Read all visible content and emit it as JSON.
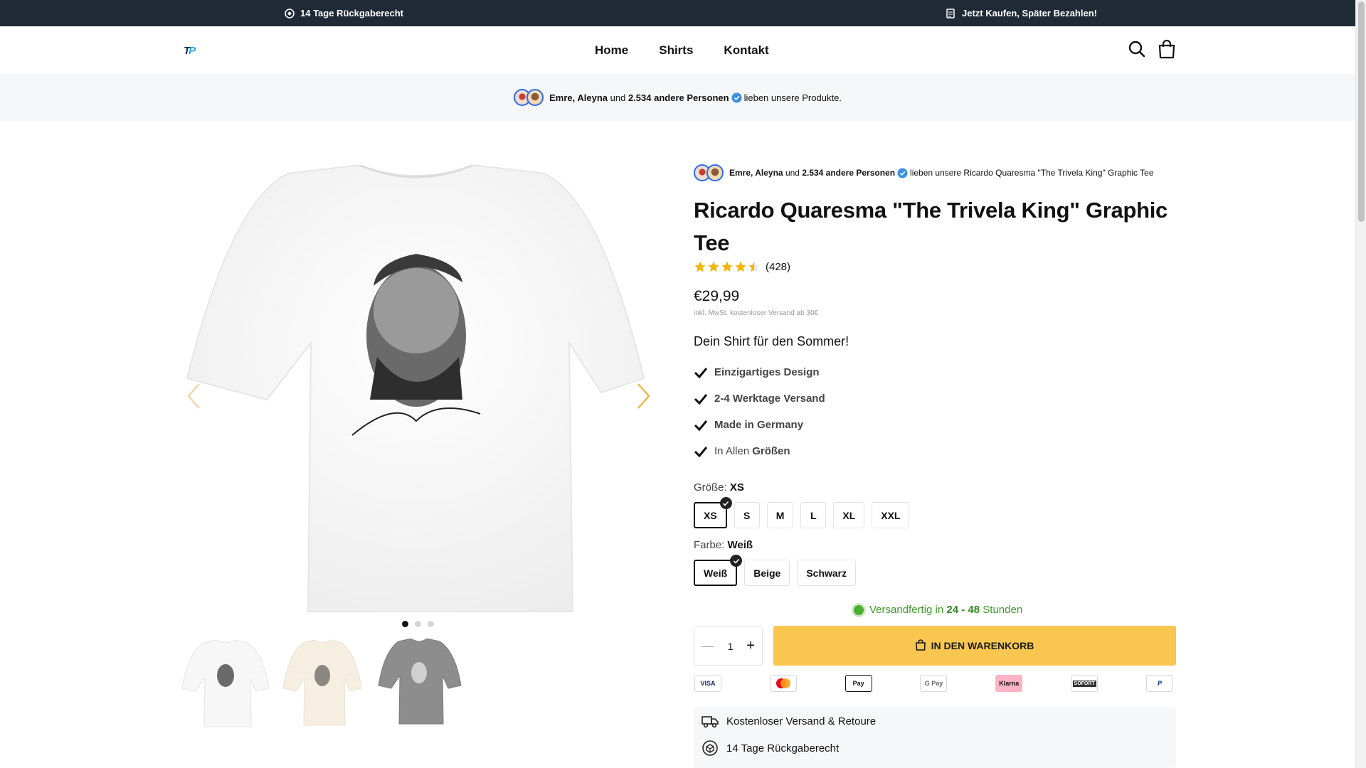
{
  "announcement": {
    "left_text": "14 Tage Rückgaberecht",
    "right_text": "Jetzt Kaufen, Später Bezahlen!"
  },
  "header": {
    "logo_text_1": "T",
    "logo_text_2": "P",
    "nav": [
      "Home",
      "Shirts",
      "Kontakt"
    ]
  },
  "social_proof": {
    "names": "Emre, Aleyna",
    "and": "und",
    "others": "2.534 andere Personen",
    "suffix": "lieben unsere Produkte."
  },
  "product": {
    "mini_proof_names": "Emre, Aleyna",
    "mini_proof_and": "und",
    "mini_proof_others": "2.534 andere Personen",
    "mini_proof_suffix": "lieben unsere Ricardo Quaresma \"The Trivela King\" Graphic Tee",
    "title": "Ricardo Quaresma \"The Trivela King\" Graphic Tee",
    "rating": 4.5,
    "rating_count": "(428)",
    "price": "€29,99",
    "tax_note": "inkl. MwSt. kostenloser Versand ab 30€",
    "tagline": "Dein Shirt für den Sommer!",
    "features": [
      "Einzigartiges Design",
      "2-4 Werktage Versand",
      "Made in Germany"
    ],
    "feature_last_prefix": "In Allen",
    "feature_last_bold": "Größen",
    "size_label": "Größe:",
    "size_selected": "XS",
    "sizes": [
      "XS",
      "S",
      "M",
      "L",
      "XL",
      "XXL"
    ],
    "color_label": "Farbe:",
    "color_selected": "Weiß",
    "colors": [
      "Weiß",
      "Beige",
      "Schwarz"
    ],
    "ship_ready_prefix": "Versandfertig in",
    "ship_ready_bold": "24 - 48",
    "ship_ready_suffix": "Stunden",
    "quantity": "1",
    "cart_button": "IN DEN WARENKORB",
    "payments": [
      "VISA",
      "",
      "Pay",
      "G Pay",
      "Klarna",
      "SOFORT",
      "P"
    ],
    "perks": [
      "Kostenloser Versand & Retoure",
      "14 Tage Rückgaberecht"
    ]
  },
  "gallery": {
    "active_index": 0,
    "image_count": 3
  },
  "colors": {
    "topbar_bg": "#1f2a36",
    "accent_yellow": "#f9c74f",
    "ship_green": "#3d9b2a",
    "verified_blue": "#3b8fe0"
  }
}
